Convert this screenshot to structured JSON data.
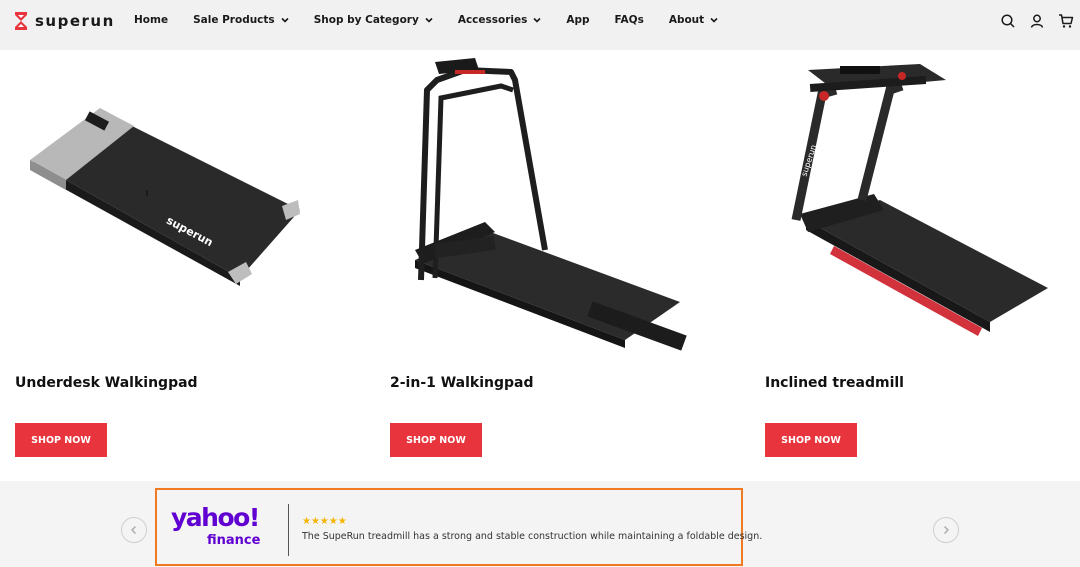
{
  "header": {
    "logo_text": "superun",
    "nav": [
      {
        "label": "Home",
        "dropdown": false
      },
      {
        "label": "Sale Products",
        "dropdown": true
      },
      {
        "label": "Shop by Category",
        "dropdown": true
      },
      {
        "label": "Accessories",
        "dropdown": true
      },
      {
        "label": "App",
        "dropdown": false
      },
      {
        "label": "FAQs",
        "dropdown": false
      },
      {
        "label": "About",
        "dropdown": true
      }
    ],
    "icons": [
      "search-icon",
      "account-icon",
      "cart-icon"
    ]
  },
  "products": [
    {
      "title": "Underdesk Walkingpad",
      "button": "SHOP NOW",
      "image": "walkingpad-image"
    },
    {
      "title": "2-in-1 Walkingpad",
      "button": "SHOP NOW",
      "image": "two-in-one-walkingpad-image"
    },
    {
      "title": "Inclined treadmill",
      "button": "SHOP NOW",
      "image": "inclined-treadmill-image"
    }
  ],
  "press": {
    "logo": "yahoo!",
    "logo_sub": "finance",
    "stars": "★★★★★",
    "rating": 5,
    "quote": "The SupeRun treadmill has a strong and stable construction while maintaining a foldable design."
  },
  "colors": {
    "accent_red": "#e8343d",
    "header_bg": "#f1f1f1",
    "yahoo_purple": "#6001d2",
    "highlight_orange": "#f07a22",
    "star_yellow": "#f4b400"
  }
}
